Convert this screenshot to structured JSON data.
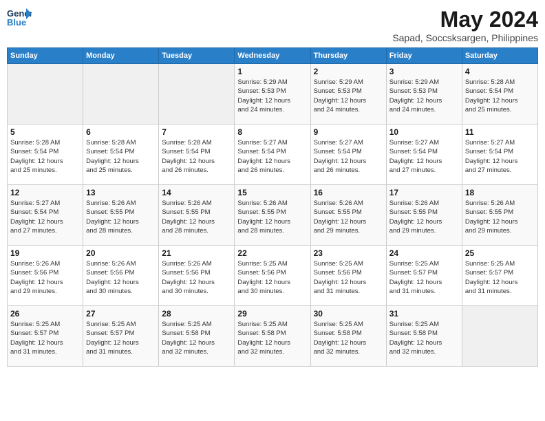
{
  "header": {
    "logo_line1": "General",
    "logo_line2": "Blue",
    "title": "May 2024",
    "subtitle": "Sapad, Soccsksargen, Philippines"
  },
  "weekdays": [
    "Sunday",
    "Monday",
    "Tuesday",
    "Wednesday",
    "Thursday",
    "Friday",
    "Saturday"
  ],
  "weeks": [
    [
      {
        "day": "",
        "info": ""
      },
      {
        "day": "",
        "info": ""
      },
      {
        "day": "",
        "info": ""
      },
      {
        "day": "1",
        "info": "Sunrise: 5:29 AM\nSunset: 5:53 PM\nDaylight: 12 hours\nand 24 minutes."
      },
      {
        "day": "2",
        "info": "Sunrise: 5:29 AM\nSunset: 5:53 PM\nDaylight: 12 hours\nand 24 minutes."
      },
      {
        "day": "3",
        "info": "Sunrise: 5:29 AM\nSunset: 5:53 PM\nDaylight: 12 hours\nand 24 minutes."
      },
      {
        "day": "4",
        "info": "Sunrise: 5:28 AM\nSunset: 5:54 PM\nDaylight: 12 hours\nand 25 minutes."
      }
    ],
    [
      {
        "day": "5",
        "info": "Sunrise: 5:28 AM\nSunset: 5:54 PM\nDaylight: 12 hours\nand 25 minutes."
      },
      {
        "day": "6",
        "info": "Sunrise: 5:28 AM\nSunset: 5:54 PM\nDaylight: 12 hours\nand 25 minutes."
      },
      {
        "day": "7",
        "info": "Sunrise: 5:28 AM\nSunset: 5:54 PM\nDaylight: 12 hours\nand 26 minutes."
      },
      {
        "day": "8",
        "info": "Sunrise: 5:27 AM\nSunset: 5:54 PM\nDaylight: 12 hours\nand 26 minutes."
      },
      {
        "day": "9",
        "info": "Sunrise: 5:27 AM\nSunset: 5:54 PM\nDaylight: 12 hours\nand 26 minutes."
      },
      {
        "day": "10",
        "info": "Sunrise: 5:27 AM\nSunset: 5:54 PM\nDaylight: 12 hours\nand 27 minutes."
      },
      {
        "day": "11",
        "info": "Sunrise: 5:27 AM\nSunset: 5:54 PM\nDaylight: 12 hours\nand 27 minutes."
      }
    ],
    [
      {
        "day": "12",
        "info": "Sunrise: 5:27 AM\nSunset: 5:54 PM\nDaylight: 12 hours\nand 27 minutes."
      },
      {
        "day": "13",
        "info": "Sunrise: 5:26 AM\nSunset: 5:55 PM\nDaylight: 12 hours\nand 28 minutes."
      },
      {
        "day": "14",
        "info": "Sunrise: 5:26 AM\nSunset: 5:55 PM\nDaylight: 12 hours\nand 28 minutes."
      },
      {
        "day": "15",
        "info": "Sunrise: 5:26 AM\nSunset: 5:55 PM\nDaylight: 12 hours\nand 28 minutes."
      },
      {
        "day": "16",
        "info": "Sunrise: 5:26 AM\nSunset: 5:55 PM\nDaylight: 12 hours\nand 29 minutes."
      },
      {
        "day": "17",
        "info": "Sunrise: 5:26 AM\nSunset: 5:55 PM\nDaylight: 12 hours\nand 29 minutes."
      },
      {
        "day": "18",
        "info": "Sunrise: 5:26 AM\nSunset: 5:55 PM\nDaylight: 12 hours\nand 29 minutes."
      }
    ],
    [
      {
        "day": "19",
        "info": "Sunrise: 5:26 AM\nSunset: 5:56 PM\nDaylight: 12 hours\nand 29 minutes."
      },
      {
        "day": "20",
        "info": "Sunrise: 5:26 AM\nSunset: 5:56 PM\nDaylight: 12 hours\nand 30 minutes."
      },
      {
        "day": "21",
        "info": "Sunrise: 5:26 AM\nSunset: 5:56 PM\nDaylight: 12 hours\nand 30 minutes."
      },
      {
        "day": "22",
        "info": "Sunrise: 5:25 AM\nSunset: 5:56 PM\nDaylight: 12 hours\nand 30 minutes."
      },
      {
        "day": "23",
        "info": "Sunrise: 5:25 AM\nSunset: 5:56 PM\nDaylight: 12 hours\nand 31 minutes."
      },
      {
        "day": "24",
        "info": "Sunrise: 5:25 AM\nSunset: 5:57 PM\nDaylight: 12 hours\nand 31 minutes."
      },
      {
        "day": "25",
        "info": "Sunrise: 5:25 AM\nSunset: 5:57 PM\nDaylight: 12 hours\nand 31 minutes."
      }
    ],
    [
      {
        "day": "26",
        "info": "Sunrise: 5:25 AM\nSunset: 5:57 PM\nDaylight: 12 hours\nand 31 minutes."
      },
      {
        "day": "27",
        "info": "Sunrise: 5:25 AM\nSunset: 5:57 PM\nDaylight: 12 hours\nand 31 minutes."
      },
      {
        "day": "28",
        "info": "Sunrise: 5:25 AM\nSunset: 5:58 PM\nDaylight: 12 hours\nand 32 minutes."
      },
      {
        "day": "29",
        "info": "Sunrise: 5:25 AM\nSunset: 5:58 PM\nDaylight: 12 hours\nand 32 minutes."
      },
      {
        "day": "30",
        "info": "Sunrise: 5:25 AM\nSunset: 5:58 PM\nDaylight: 12 hours\nand 32 minutes."
      },
      {
        "day": "31",
        "info": "Sunrise: 5:25 AM\nSunset: 5:58 PM\nDaylight: 12 hours\nand 32 minutes."
      },
      {
        "day": "",
        "info": ""
      }
    ]
  ]
}
